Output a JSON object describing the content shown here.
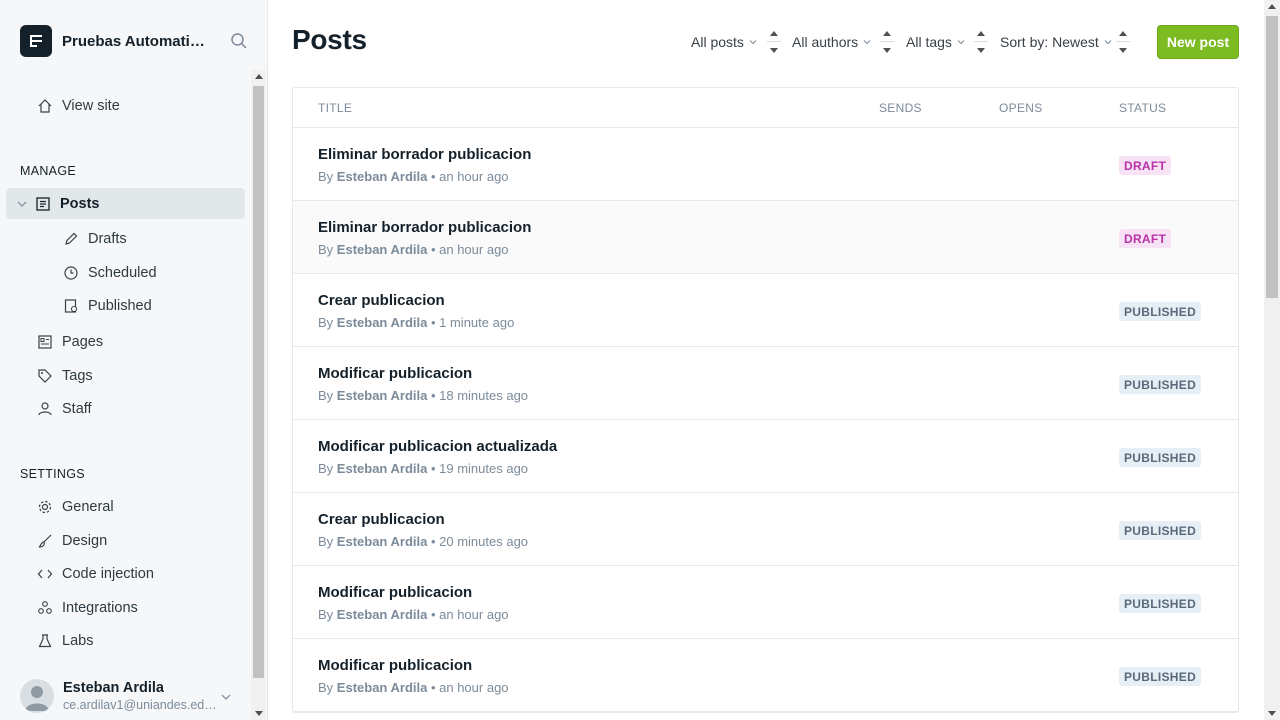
{
  "sidebar": {
    "site_title": "Pruebas Automatizadas",
    "view_site": "View site",
    "manage_label": "MANAGE",
    "posts": "Posts",
    "drafts": "Drafts",
    "scheduled": "Scheduled",
    "published": "Published",
    "pages": "Pages",
    "tags": "Tags",
    "staff": "Staff",
    "settings_label": "SETTINGS",
    "general": "General",
    "design": "Design",
    "code_injection": "Code injection",
    "integrations": "Integrations",
    "labs": "Labs",
    "user_name": "Esteban Ardila",
    "user_email": "ce.ardilav1@uniandes.edu.co"
  },
  "main": {
    "title": "Posts",
    "filters": {
      "type": "All posts",
      "author": "All authors",
      "tag": "All tags",
      "sort": "Sort by: Newest"
    },
    "new_post": "New post",
    "columns": {
      "title": "TITLE",
      "sends": "SENDS",
      "opens": "OPENS",
      "status": "STATUS"
    },
    "posts": [
      {
        "title": "Eliminar borrador publicacion",
        "by": "By",
        "author": "Esteban Ardila",
        "time": "• an hour ago",
        "status": "DRAFT"
      },
      {
        "title": "Eliminar borrador publicacion",
        "by": "By",
        "author": "Esteban Ardila",
        "time": "• an hour ago",
        "status": "DRAFT"
      },
      {
        "title": "Crear publicacion",
        "by": "By",
        "author": "Esteban Ardila",
        "time": "• 1 minute ago",
        "status": "PUBLISHED"
      },
      {
        "title": "Modificar publicacion",
        "by": "By",
        "author": "Esteban Ardila",
        "time": "• 18 minutes ago",
        "status": "PUBLISHED"
      },
      {
        "title": "Modificar publicacion actualizada",
        "by": "By",
        "author": "Esteban Ardila",
        "time": "• 19 minutes ago",
        "status": "PUBLISHED"
      },
      {
        "title": "Crear publicacion",
        "by": "By",
        "author": "Esteban Ardila",
        "time": "• 20 minutes ago",
        "status": "PUBLISHED"
      },
      {
        "title": "Modificar publicacion",
        "by": "By",
        "author": "Esteban Ardila",
        "time": "• an hour ago",
        "status": "PUBLISHED"
      },
      {
        "title": "Modificar publicacion",
        "by": "By",
        "author": "Esteban Ardila",
        "time": "• an hour ago",
        "status": "PUBLISHED"
      }
    ]
  },
  "colors": {
    "accent": "#7cbb22",
    "draft_bg": "#f8e2f5",
    "draft_text": "#b832a8",
    "published_bg": "#e5eff5",
    "published_text": "#5a6a7a"
  },
  "icons": {
    "logo": "ghost-logo-icon",
    "search": "search-icon",
    "view_site": "home-icon",
    "posts": "document-icon",
    "drafts": "pencil-icon",
    "scheduled": "clock-icon",
    "published": "published-document-icon",
    "pages": "pages-icon",
    "tags": "tag-icon",
    "staff": "staff-icon",
    "general": "gear-icon",
    "design": "brush-icon",
    "code_injection": "code-icon",
    "integrations": "integrations-icon",
    "labs": "flask-icon"
  }
}
